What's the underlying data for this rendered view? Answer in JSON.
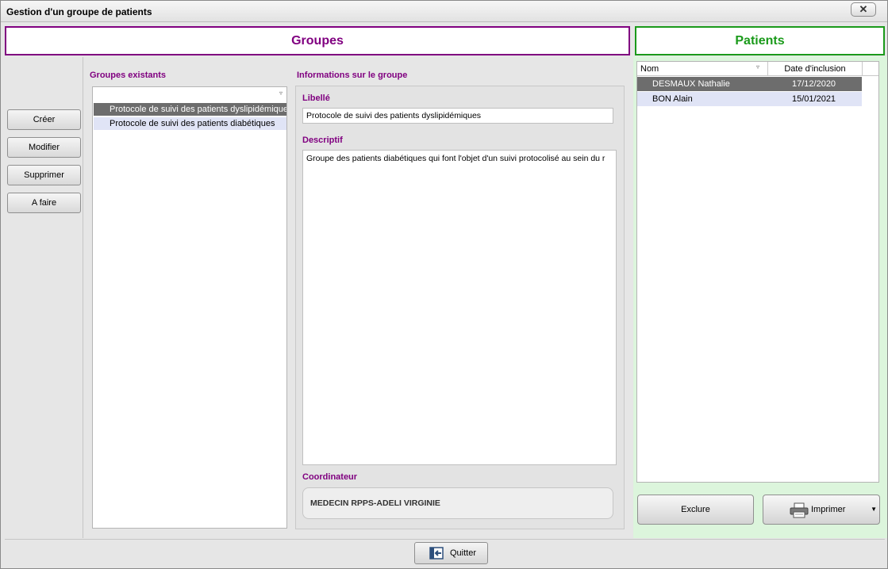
{
  "window": {
    "title": "Gestion d'un groupe de patients",
    "close_glyph": "✕"
  },
  "groupes": {
    "header": "Groupes",
    "actions": [
      "Créer",
      "Modifier",
      "Supprimer",
      "A faire"
    ],
    "list_label": "Groupes existants",
    "items": [
      "Protocole de suivi des patients dyslipidémiques",
      "Protocole de suivi des patients diabétiques"
    ],
    "selected_index": 0
  },
  "info": {
    "section_label": "Informations sur le groupe",
    "libelle_label": "Libellé",
    "libelle_value": "Protocole de suivi des patients dyslipidémiques",
    "descriptif_label": "Descriptif",
    "descriptif_value": "Groupe des patients diabétiques qui font l'objet d'un suivi protocolisé au sein du r",
    "coordinateur_label": "Coordinateur",
    "coordinateur_value": "MEDECIN RPPS-ADELI VIRGINIE"
  },
  "patients": {
    "header": "Patients",
    "columns": {
      "nom": "Nom",
      "date": "Date d'inclusion"
    },
    "rows": [
      {
        "nom": "DESMAUX Nathalie",
        "date": "17/12/2020"
      },
      {
        "nom": "BON Alain",
        "date": "15/01/2021"
      }
    ],
    "selected_index": 0,
    "exclude_label": "Exclure",
    "print_label": "Imprimer"
  },
  "footer": {
    "quit_label": "Quitter"
  },
  "colors": {
    "groupes_accent": "#800080",
    "patients_accent": "#1a9a1a",
    "selection": "#6d6d6d",
    "alt_row": "#e0e4f6"
  },
  "icons": {
    "sort": "sort-icon",
    "printer": "printer-icon",
    "quit": "exit-icon",
    "dropdown": "chevron-down-icon"
  }
}
